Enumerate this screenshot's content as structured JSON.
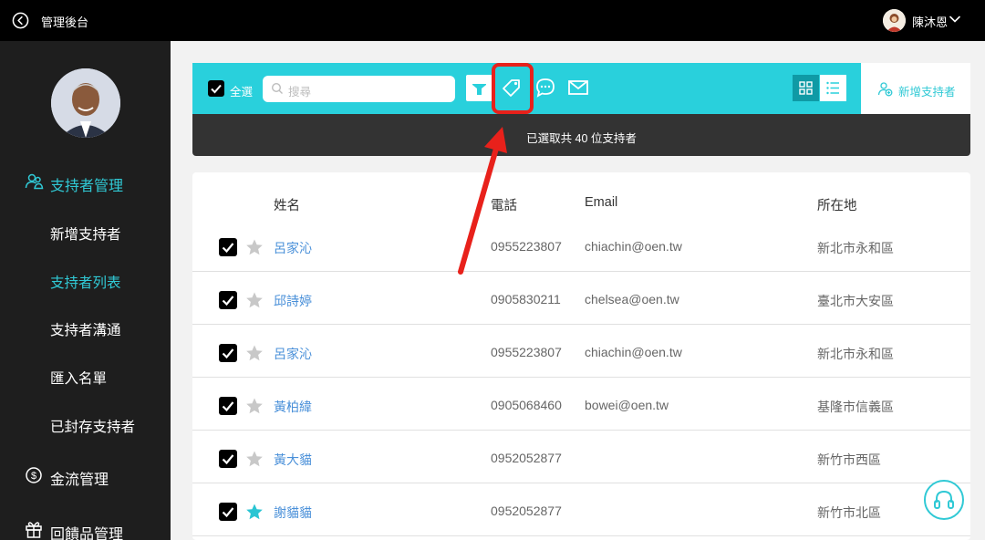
{
  "topbar": {
    "title": "管理後台",
    "username": "陳沐恩"
  },
  "sidebar": {
    "items": [
      {
        "label": "支持者管理",
        "icon": "users-icon",
        "active": true
      },
      {
        "label": "新增支持者"
      },
      {
        "label": "支持者列表",
        "active": true
      },
      {
        "label": "支持者溝通"
      },
      {
        "label": "匯入名單"
      },
      {
        "label": "已封存支持者"
      },
      {
        "label": "金流管理",
        "icon": "dollar-circle-icon"
      },
      {
        "label": "回饋品管理",
        "icon": "gift-icon"
      }
    ]
  },
  "toolbar": {
    "select_all_label": "全選",
    "search_placeholder": "搜尋",
    "add_supporter_label": "新增支持者"
  },
  "banner": {
    "text": "已選取共 40 位支持者"
  },
  "table": {
    "headers": {
      "name": "姓名",
      "phone": "電話",
      "email": "Email",
      "location": "所在地"
    },
    "rows": [
      {
        "name": "呂家沁",
        "phone": "0955223807",
        "email": "chiachin@oen.tw",
        "location": "新北市永和區",
        "starred": false,
        "checked": true
      },
      {
        "name": "邱詩婷",
        "phone": "0905830211",
        "email": "chelsea@oen.tw",
        "location": "臺北市大安區",
        "starred": false,
        "checked": true
      },
      {
        "name": "呂家沁",
        "phone": "0955223807",
        "email": "chiachin@oen.tw",
        "location": "新北市永和區",
        "starred": false,
        "checked": true
      },
      {
        "name": "黃柏緯",
        "phone": "0905068460",
        "email": "bowei@oen.tw",
        "location": "基隆市信義區",
        "starred": false,
        "checked": true
      },
      {
        "name": "黃大貓",
        "phone": "0952052877",
        "email": "",
        "location": "新竹市西區",
        "starred": false,
        "checked": true
      },
      {
        "name": "謝貓貓",
        "phone": "0952052877",
        "email": "",
        "location": "新竹市北區",
        "starred": true,
        "checked": true
      }
    ]
  },
  "colors": {
    "accent": "#29d0dc",
    "accent_text": "#30c9d5",
    "highlight": "#e8211b",
    "link": "#4a90d9"
  }
}
